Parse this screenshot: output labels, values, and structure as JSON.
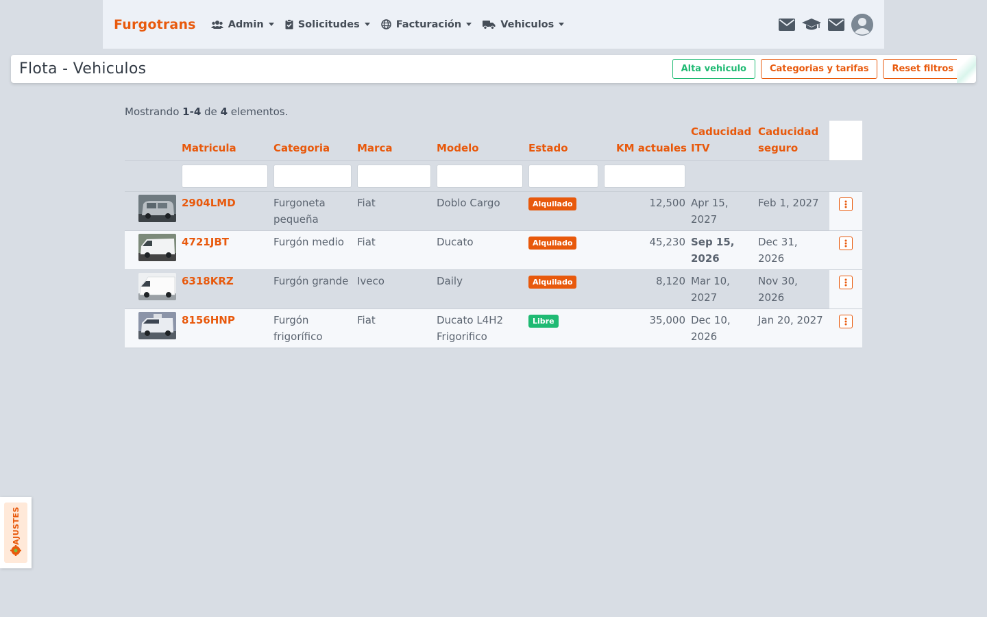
{
  "navbar": {
    "brand": "Furgotrans",
    "items": [
      {
        "label": "Admin",
        "icon": "users-icon"
      },
      {
        "label": "Solicitudes",
        "icon": "clipboard-check-icon"
      },
      {
        "label": "Facturación",
        "icon": "globe-icon"
      },
      {
        "label": "Vehiculos",
        "icon": "truck-icon"
      }
    ],
    "right_icons": [
      "envelope-icon",
      "graduation-cap-icon",
      "envelope-icon",
      "user-avatar-icon"
    ]
  },
  "header": {
    "title": "Flota - Vehiculos",
    "buttons": {
      "alta": "Alta vehiculo",
      "categorias": "Categorias y tarifas",
      "reset": "Reset filtros"
    }
  },
  "summary": {
    "prefix": "Mostrando ",
    "range": "1-4",
    "middle": " de ",
    "total": "4",
    "suffix": " elementos."
  },
  "table": {
    "columns": {
      "matricula": "Matricula",
      "categoria": "Categoria",
      "marca": "Marca",
      "modelo": "Modelo",
      "estado": "Estado",
      "km": "KM actuales",
      "itv": "Caducidad ITV",
      "seguro": "Caducidad seguro"
    },
    "rows": [
      {
        "matricula": "2904LMD",
        "categoria": "Furgoneta pequeña",
        "marca": "Fiat",
        "modelo": "Doblo Cargo",
        "estado": "Alquilado",
        "km": "12,500",
        "itv": "Apr 15, 2027",
        "seguro": "Feb 1, 2027"
      },
      {
        "matricula": "4721JBT",
        "categoria": "Furgón medio",
        "marca": "Fiat",
        "modelo": "Ducato",
        "estado": "Alquilado",
        "km": "45,230",
        "itv": "Sep 15, 2026",
        "seguro": "Dec 31, 2026"
      },
      {
        "matricula": "6318KRZ",
        "categoria": "Furgón grande",
        "marca": "Iveco",
        "modelo": "Daily",
        "estado": "Alquilado",
        "km": "8,120",
        "itv": "Mar 10, 2027",
        "seguro": "Nov 30, 2026"
      },
      {
        "matricula": "8156HNP",
        "categoria": "Furgón frigorífico",
        "marca": "Fiat",
        "modelo": "Ducato L4H2 Frigorifico",
        "estado": "Libre",
        "km": "35,000",
        "itv": "Dec 10, 2026",
        "seguro": "Jan 20, 2027"
      }
    ]
  },
  "settings_tab": {
    "label": "AJUSTES",
    "icon": "gear-icon"
  },
  "colors": {
    "accent": "#e8590c",
    "success": "#1fba73",
    "background": "#d8dde4",
    "navbar": "#edf1f7"
  }
}
